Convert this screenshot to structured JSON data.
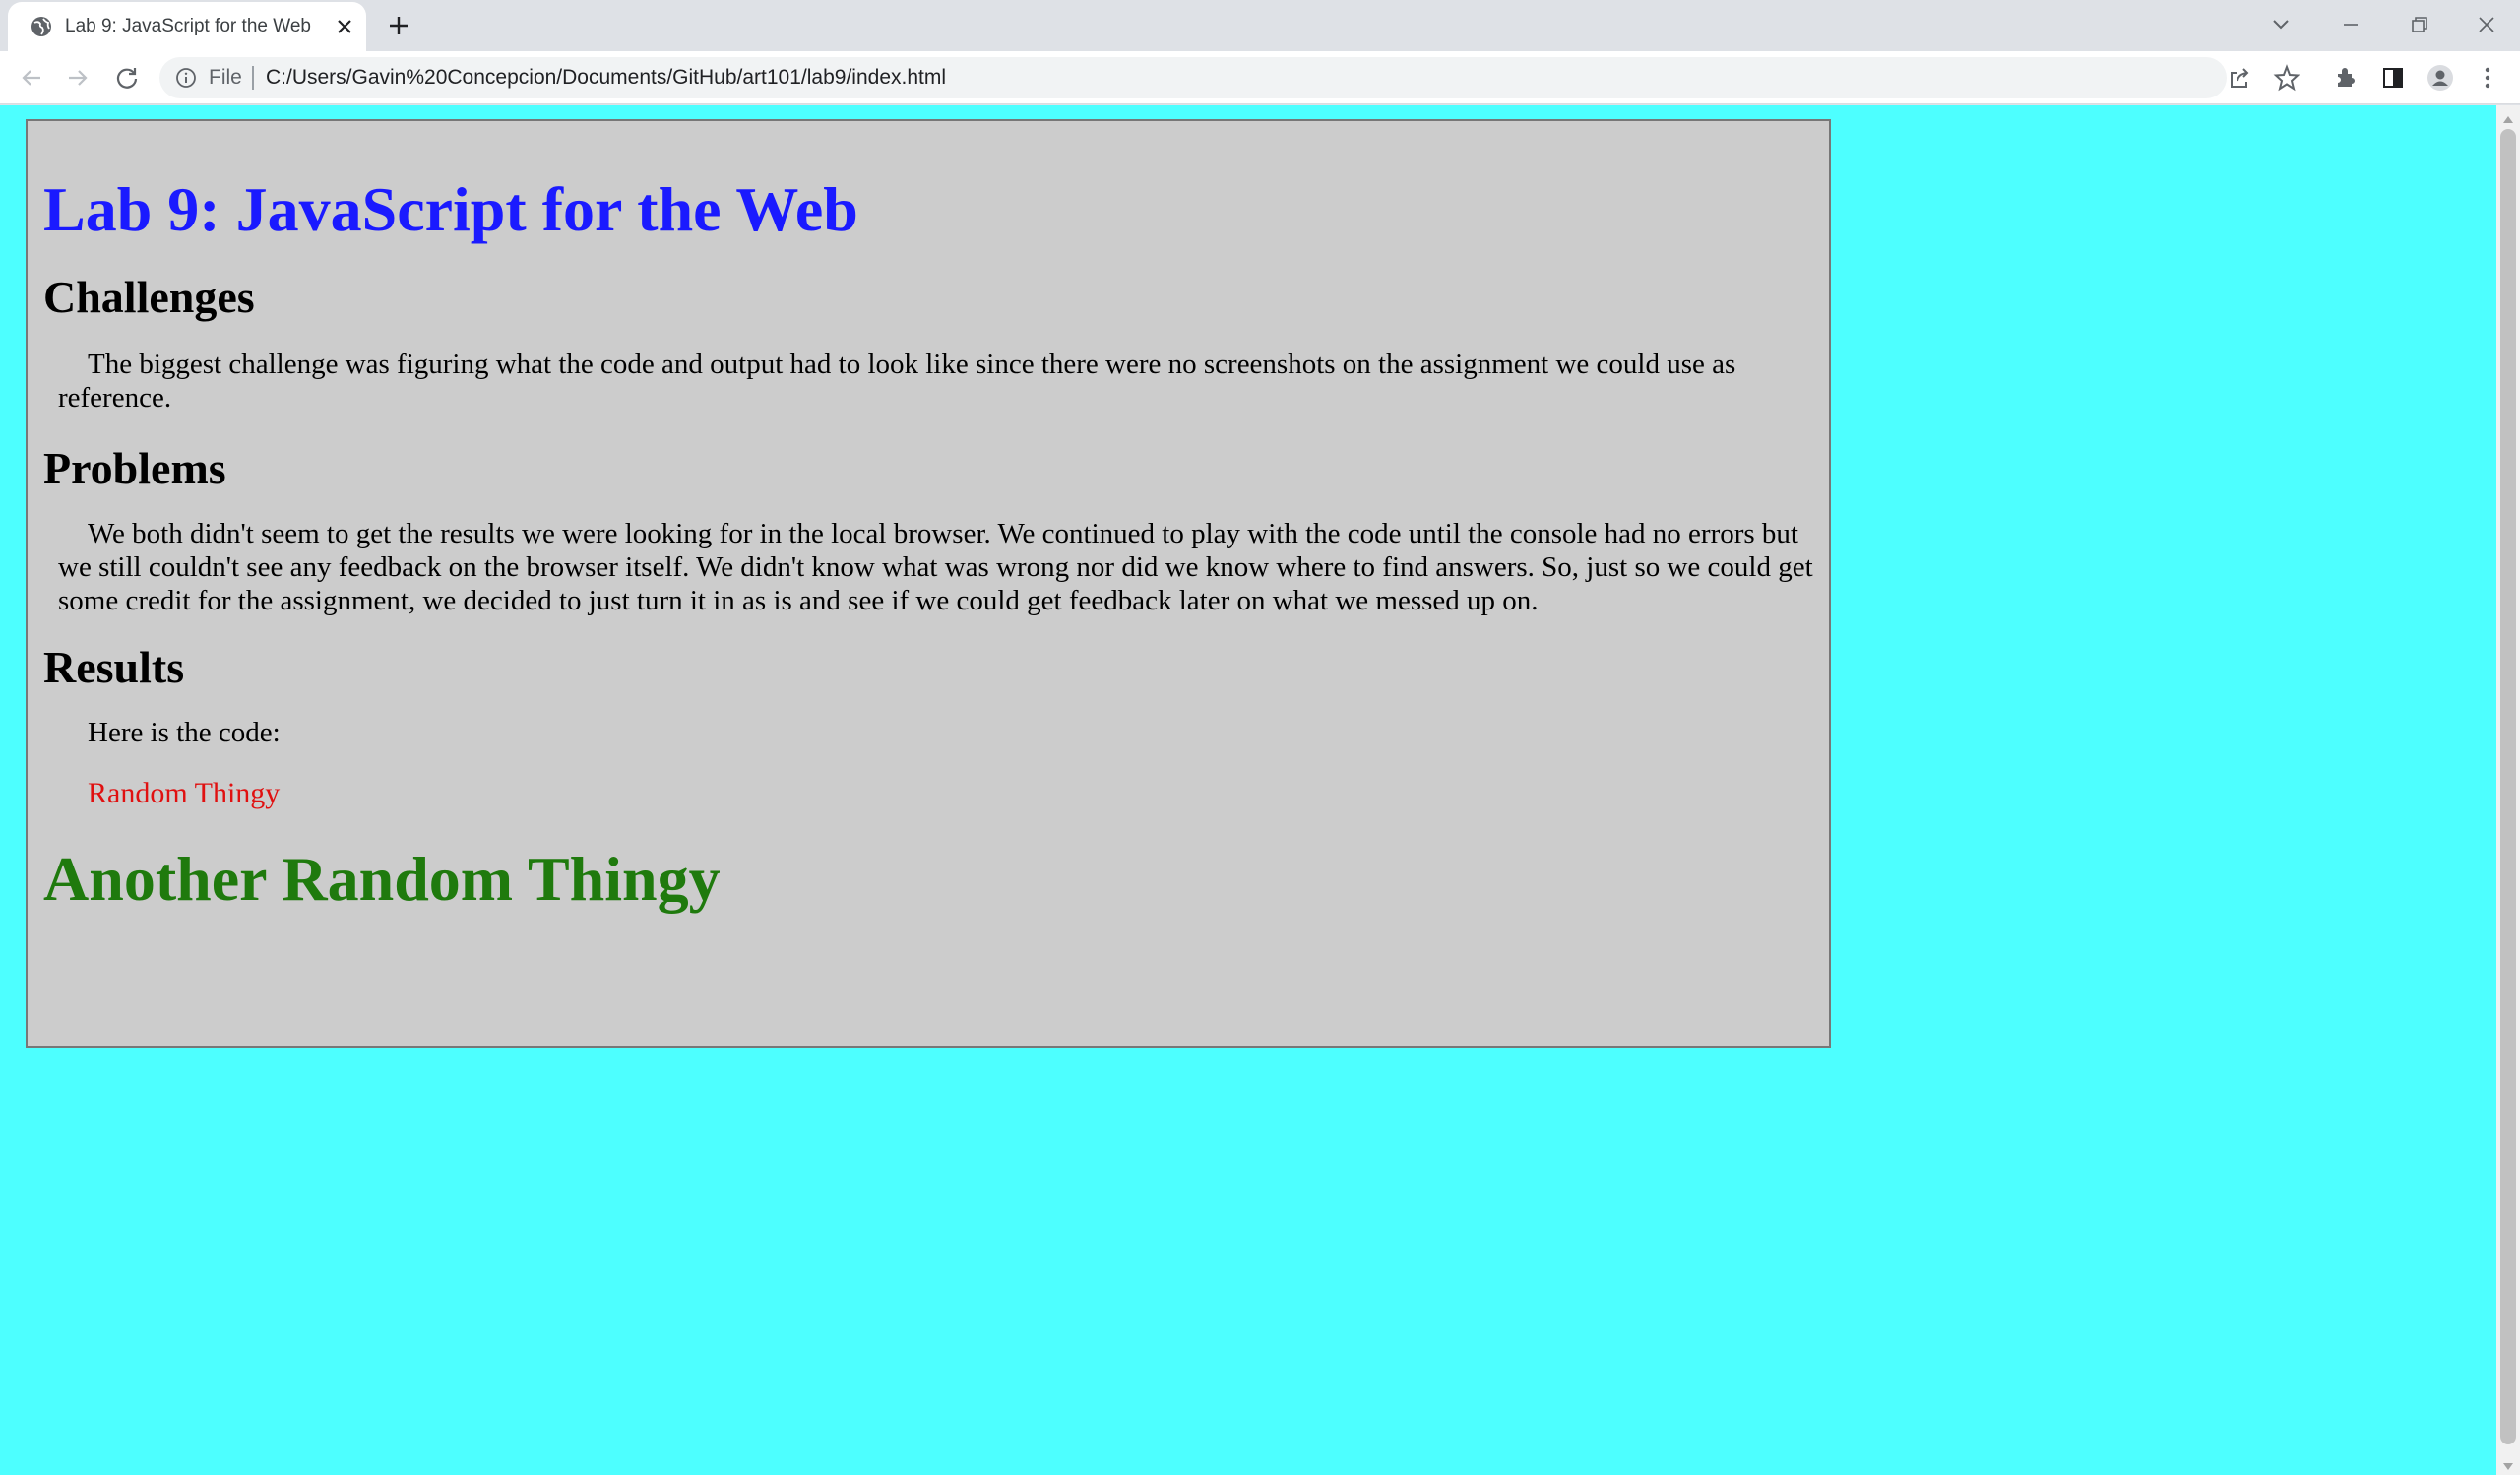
{
  "browser": {
    "tab": {
      "title": "Lab 9: JavaScript for the Web",
      "favicon": "globe-icon"
    },
    "address_bar": {
      "scheme_label": "File",
      "url": "C:/Users/Gavin%20Concepcion/Documents/GitHub/art101/lab9/index.html"
    },
    "icons": [
      "back-icon",
      "forward-icon",
      "reload-icon",
      "info-icon",
      "share-icon",
      "star-icon",
      "extensions-icon",
      "side-panel-icon",
      "profile-icon",
      "menu-icon",
      "tab-search-icon",
      "minimize-icon",
      "restore-icon",
      "close-window-icon",
      "new-tab-icon",
      "close-icon"
    ]
  },
  "page": {
    "background": "#4dffff",
    "box_background": "#cccccc",
    "title": "Lab 9: JavaScript for the Web",
    "title_color": "#1a1aff",
    "sections": {
      "challenges": {
        "heading": "Challenges",
        "text": "The biggest challenge was figuring what the code and output had to look like since there were no screenshots on the assignment we could use as reference."
      },
      "problems": {
        "heading": "Problems",
        "text": "We both didn't seem to get the results we were looking for in the local browser. We continued to play with the code until the console had no errors but we still couldn't see any feedback on the browser itself. We didn't know what was wrong nor did we know where to find answers. So, just so we could get some credit for the assignment, we decided to just turn it in as is and see if we could get feedback later on what we messed up on."
      },
      "results": {
        "heading": "Results",
        "text": "Here is the code:"
      }
    },
    "random_thingy": "Random Thingy",
    "random_thingy_color": "#e01010",
    "another_random_thingy": "Another Random Thingy",
    "another_random_thingy_color": "#1f7a0d"
  }
}
